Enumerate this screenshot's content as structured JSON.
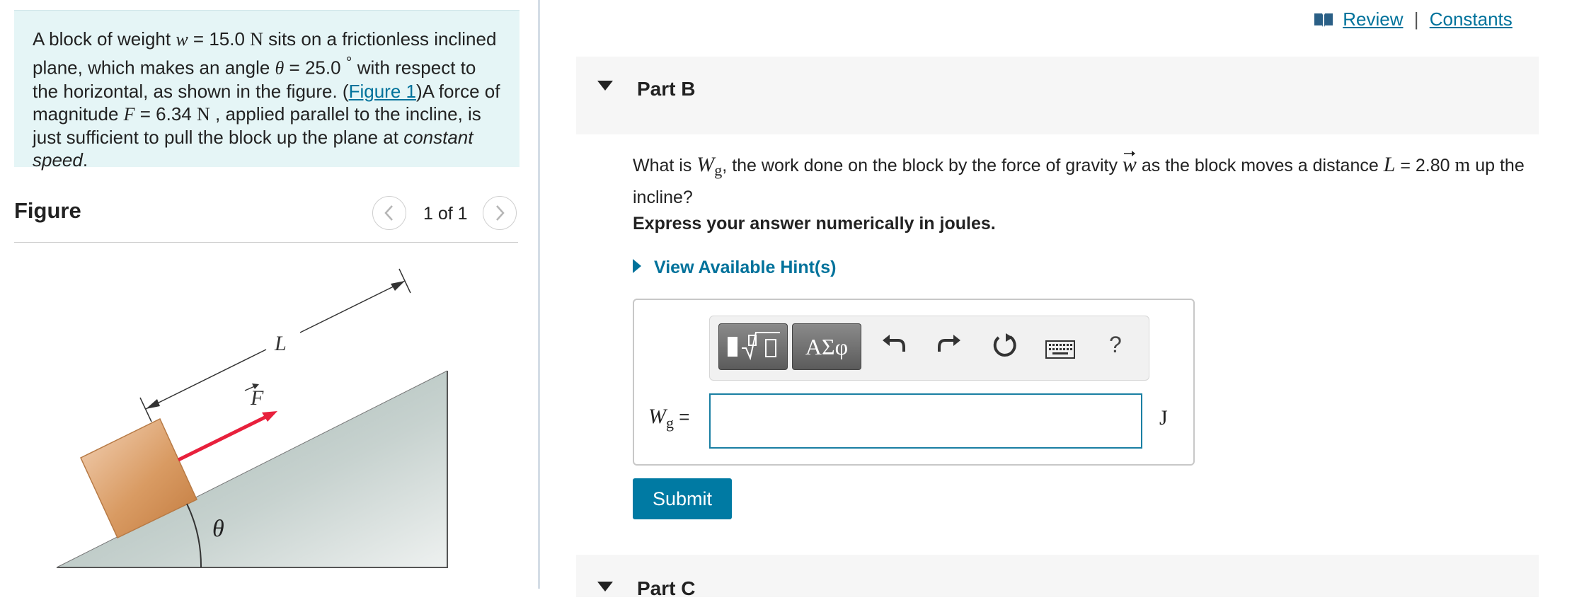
{
  "problem": {
    "t1": "A block of weight ",
    "w_sym": "w",
    "w_val": " = 15.0 ",
    "w_unit": "N",
    "t2": " sits on a frictionless inclined plane, which makes an angle ",
    "theta_sym": "θ",
    "theta_val": " = 25.0 ",
    "deg": "°",
    "t3": " with respect to the horizontal, as shown in the figure. (",
    "fig_link": "Figure 1",
    "t4": ")A force of magnitude ",
    "f_sym": "F",
    "f_val": " = 6.34 ",
    "f_unit": "N",
    "t5": " , applied parallel to the incline, is just sufficient to pull the block up the plane at ",
    "t6": "constant speed",
    "t7": "."
  },
  "figure": {
    "title": "Figure",
    "pager": "1 of 1",
    "prev_icon": "chevron-left-icon",
    "next_icon": "chevron-right-icon",
    "label_L": "L",
    "label_F": "F",
    "label_theta": "θ",
    "colors": {
      "block": "#d4915a",
      "force": "#e8203c",
      "incline": "#b9c7c4"
    }
  },
  "links": {
    "review": "Review",
    "sep": "|",
    "constants": "Constants",
    "book_icon": "book-icon"
  },
  "partB": {
    "title": "Part B",
    "q1": "What is ",
    "q_W": "W",
    "q_g": "g",
    "q2": ", the work done on the block by the force of gravity ",
    "q_w": "w",
    "q3": " as the block moves a distance ",
    "q_L": "L",
    "q4": " = 2.80 ",
    "q_m": "m",
    "q5": " up the incline?",
    "instruction": "Express your answer numerically in joules.",
    "hint": "View Available Hint(s)",
    "toolbar": {
      "symbols": "ΑΣφ",
      "help": "?",
      "icons": [
        "templates-icon",
        "undo-icon",
        "redo-icon",
        "reset-icon",
        "keyboard-icon"
      ]
    },
    "answer_label_W": "W",
    "answer_label_sub": "g",
    "answer_eq": " =",
    "answer_value": "",
    "unit": "J",
    "submit": "Submit"
  },
  "partC": {
    "title": "Part C"
  },
  "accent_color": "#007aa3"
}
